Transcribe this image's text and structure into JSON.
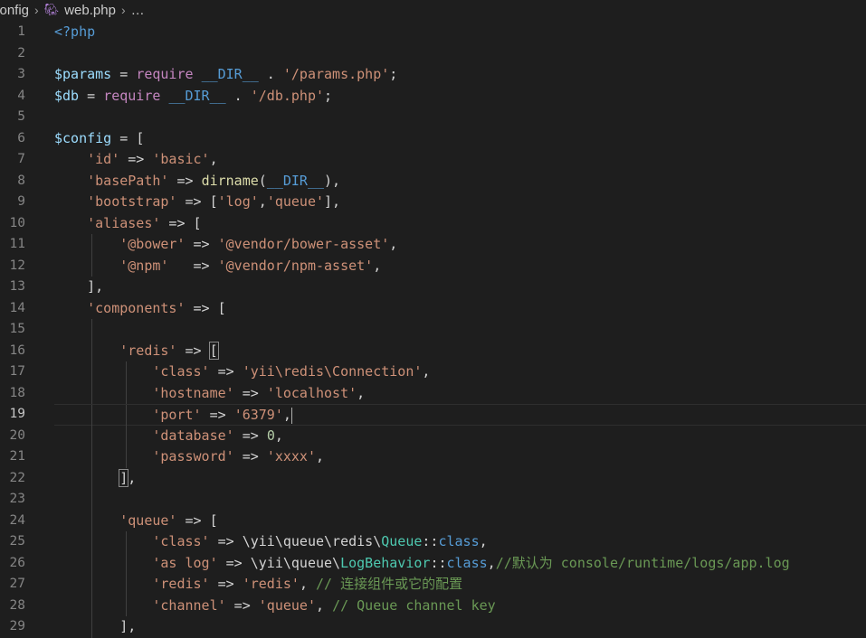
{
  "breadcrumb": {
    "items": [
      "config",
      "web.php",
      "…"
    ],
    "file_icon": "php-elephant-icon"
  },
  "editor": {
    "active_line": 19,
    "lines": [
      {
        "n": "1",
        "indent": 0,
        "tokens": [
          [
            "tag",
            "<?php"
          ]
        ]
      },
      {
        "n": "2",
        "indent": 0,
        "tokens": []
      },
      {
        "n": "3",
        "indent": 0,
        "tokens": [
          [
            "var",
            "$params"
          ],
          [
            "op",
            " = "
          ],
          [
            "kw",
            "require"
          ],
          [
            "op",
            " "
          ],
          [
            "const",
            "__DIR__"
          ],
          [
            "op",
            " . "
          ],
          [
            "str",
            "'/params.php'"
          ],
          [
            "op",
            ";"
          ]
        ]
      },
      {
        "n": "4",
        "indent": 0,
        "tokens": [
          [
            "var",
            "$db"
          ],
          [
            "op",
            " = "
          ],
          [
            "kw",
            "require"
          ],
          [
            "op",
            " "
          ],
          [
            "const",
            "__DIR__"
          ],
          [
            "op",
            " . "
          ],
          [
            "str",
            "'/db.php'"
          ],
          [
            "op",
            ";"
          ]
        ]
      },
      {
        "n": "5",
        "indent": 0,
        "tokens": []
      },
      {
        "n": "6",
        "indent": 0,
        "tokens": [
          [
            "var",
            "$config"
          ],
          [
            "op",
            " = "
          ],
          [
            "br",
            "["
          ]
        ]
      },
      {
        "n": "7",
        "indent": 1,
        "tokens": [
          [
            "str",
            "'id'"
          ],
          [
            "op",
            " => "
          ],
          [
            "str",
            "'basic'"
          ],
          [
            "op",
            ","
          ]
        ]
      },
      {
        "n": "8",
        "indent": 1,
        "tokens": [
          [
            "str",
            "'basePath'"
          ],
          [
            "op",
            " => "
          ],
          [
            "fn",
            "dirname"
          ],
          [
            "op",
            "("
          ],
          [
            "const",
            "__DIR__"
          ],
          [
            "op",
            "),"
          ]
        ]
      },
      {
        "n": "9",
        "indent": 1,
        "tokens": [
          [
            "str",
            "'bootstrap'"
          ],
          [
            "op",
            " => ["
          ],
          [
            "str",
            "'log'"
          ],
          [
            "op",
            ","
          ],
          [
            "str",
            "'queue'"
          ],
          [
            "op",
            "],"
          ]
        ]
      },
      {
        "n": "10",
        "indent": 1,
        "tokens": [
          [
            "str",
            "'aliases'"
          ],
          [
            "op",
            " => "
          ],
          [
            "br",
            "["
          ]
        ]
      },
      {
        "n": "11",
        "indent": 2,
        "tokens": [
          [
            "str",
            "'@bower'"
          ],
          [
            "op",
            " => "
          ],
          [
            "str",
            "'@vendor/bower-asset'"
          ],
          [
            "op",
            ","
          ]
        ]
      },
      {
        "n": "12",
        "indent": 2,
        "tokens": [
          [
            "str",
            "'@npm'"
          ],
          [
            "op",
            "   => "
          ],
          [
            "str",
            "'@vendor/npm-asset'"
          ],
          [
            "op",
            ","
          ]
        ]
      },
      {
        "n": "13",
        "indent": 1,
        "tokens": [
          [
            "br",
            "]"
          ],
          [
            "op",
            ","
          ]
        ]
      },
      {
        "n": "14",
        "indent": 1,
        "tokens": [
          [
            "str",
            "'components'"
          ],
          [
            "op",
            " => "
          ],
          [
            "br",
            "["
          ]
        ]
      },
      {
        "n": "15",
        "indent": 2,
        "tokens": []
      },
      {
        "n": "16",
        "indent": 2,
        "tokens": [
          [
            "str",
            "'redis'"
          ],
          [
            "op",
            " => "
          ],
          [
            "brm",
            "["
          ]
        ]
      },
      {
        "n": "17",
        "indent": 3,
        "tokens": [
          [
            "str",
            "'class'"
          ],
          [
            "op",
            " => "
          ],
          [
            "str",
            "'yii\\redis\\Connection'"
          ],
          [
            "op",
            ","
          ]
        ]
      },
      {
        "n": "18",
        "indent": 3,
        "tokens": [
          [
            "str",
            "'hostname'"
          ],
          [
            "op",
            " => "
          ],
          [
            "str",
            "'localhost'"
          ],
          [
            "op",
            ","
          ]
        ]
      },
      {
        "n": "19",
        "indent": 3,
        "tokens": [
          [
            "str",
            "'port'"
          ],
          [
            "op",
            " => "
          ],
          [
            "str",
            "'6379'"
          ],
          [
            "op",
            ","
          ]
        ],
        "cursor": true
      },
      {
        "n": "20",
        "indent": 3,
        "tokens": [
          [
            "str",
            "'database'"
          ],
          [
            "op",
            " => "
          ],
          [
            "num",
            "0"
          ],
          [
            "op",
            ","
          ]
        ]
      },
      {
        "n": "21",
        "indent": 3,
        "tokens": [
          [
            "str",
            "'password'"
          ],
          [
            "op",
            " => "
          ],
          [
            "str",
            "'xxxx'"
          ],
          [
            "op",
            ","
          ]
        ]
      },
      {
        "n": "22",
        "indent": 2,
        "tokens": [
          [
            "brm",
            "]"
          ],
          [
            "op",
            ","
          ]
        ]
      },
      {
        "n": "23",
        "indent": 2,
        "tokens": []
      },
      {
        "n": "24",
        "indent": 2,
        "tokens": [
          [
            "str",
            "'queue'"
          ],
          [
            "op",
            " => "
          ],
          [
            "br",
            "["
          ]
        ]
      },
      {
        "n": "25",
        "indent": 3,
        "tokens": [
          [
            "str",
            "'class'"
          ],
          [
            "op",
            " => \\yii\\queue\\redis\\"
          ],
          [
            "class",
            "Queue"
          ],
          [
            "op",
            "::"
          ],
          [
            "const",
            "class"
          ],
          [
            "op",
            ","
          ]
        ]
      },
      {
        "n": "26",
        "indent": 3,
        "tokens": [
          [
            "str",
            "'as log'"
          ],
          [
            "op",
            " => \\yii\\queue\\"
          ],
          [
            "class",
            "LogBehavior"
          ],
          [
            "op",
            "::"
          ],
          [
            "const",
            "class"
          ],
          [
            "op",
            ","
          ],
          [
            "com",
            "//默认为 console/runtime/logs/app.log"
          ]
        ]
      },
      {
        "n": "27",
        "indent": 3,
        "tokens": [
          [
            "str",
            "'redis'"
          ],
          [
            "op",
            " => "
          ],
          [
            "str",
            "'redis'"
          ],
          [
            "op",
            ", "
          ],
          [
            "com",
            "// 连接组件或它的配置"
          ]
        ]
      },
      {
        "n": "28",
        "indent": 3,
        "tokens": [
          [
            "str",
            "'channel'"
          ],
          [
            "op",
            " => "
          ],
          [
            "str",
            "'queue'"
          ],
          [
            "op",
            ", "
          ],
          [
            "com",
            "// Queue channel key"
          ]
        ]
      },
      {
        "n": "29",
        "indent": 2,
        "tokens": [
          [
            "br",
            "],"
          ]
        ]
      }
    ]
  },
  "colors": {
    "background": "#1e1e1e",
    "variable": "#9cdcfe",
    "keyword": "#c586c0",
    "constant": "#569cd6",
    "string": "#ce9178",
    "function": "#dcdcaa",
    "class": "#4ec9b0",
    "number": "#b5cea8",
    "comment": "#6a9955"
  }
}
